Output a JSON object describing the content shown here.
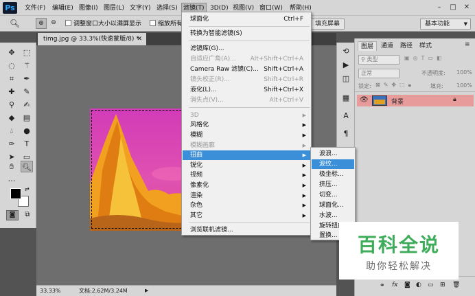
{
  "app": {
    "logo": "Ps"
  },
  "menubar": {
    "items": [
      "文件(F)",
      "编辑(E)",
      "图像(I)",
      "图层(L)",
      "文字(Y)",
      "选择(S)",
      "滤镜(T)",
      "3D(D)",
      "视图(V)",
      "窗口(W)",
      "帮助(H)"
    ],
    "active_index": 6
  },
  "options_bar": {
    "resize_windows": "调整窗口大小以满屏显示",
    "zoom_all": "缩放所有",
    "fill_screen": "填充屏幕",
    "workspace": "基本功能"
  },
  "document": {
    "tab_title": "timg.jpg @ 33.3%(快速蒙版/8) *",
    "zoom": "33.33%",
    "doc_info": "文档:2.62M/3.24M"
  },
  "filter_menu": {
    "items": [
      {
        "label": "球面化",
        "shortcut": "Ctrl+F",
        "disabled": false
      },
      {
        "label": "转换为智能滤镜(S)",
        "disabled": false
      },
      {
        "label": "滤镜库(G)...",
        "disabled": false
      },
      {
        "label": "自适应广角(A)...",
        "shortcut": "Alt+Shift+Ctrl+A",
        "disabled": true
      },
      {
        "label": "Camera Raw 滤镜(C)...",
        "shortcut": "Shift+Ctrl+A",
        "disabled": false
      },
      {
        "label": "镜头校正(R)...",
        "shortcut": "Shift+Ctrl+R",
        "disabled": true
      },
      {
        "label": "液化(L)...",
        "shortcut": "Shift+Ctrl+X",
        "disabled": false
      },
      {
        "label": "消失点(V)...",
        "shortcut": "Alt+Ctrl+V",
        "disabled": true
      },
      {
        "label": "3D",
        "submenu": true,
        "disabled": true
      },
      {
        "label": "风格化",
        "submenu": true,
        "disabled": false
      },
      {
        "label": "模糊",
        "submenu": true,
        "disabled": false
      },
      {
        "label": "模糊画廊",
        "submenu": true,
        "disabled": true
      },
      {
        "label": "扭曲",
        "submenu": true,
        "disabled": false,
        "highlighted": true
      },
      {
        "label": "锐化",
        "submenu": true,
        "disabled": false
      },
      {
        "label": "视频",
        "submenu": true,
        "disabled": false
      },
      {
        "label": "像素化",
        "submenu": true,
        "disabled": false
      },
      {
        "label": "渲染",
        "submenu": true,
        "disabled": false
      },
      {
        "label": "杂色",
        "submenu": true,
        "disabled": false
      },
      {
        "label": "其它",
        "submenu": true,
        "disabled": false
      },
      {
        "label": "浏览联机滤镜...",
        "disabled": false
      }
    ]
  },
  "distort_submenu": {
    "items": [
      "波浪...",
      "波纹...",
      "极坐标...",
      "挤压...",
      "切变...",
      "球面化...",
      "水波...",
      "旋转扭曲...",
      "置换..."
    ],
    "highlighted_index": 1
  },
  "layers_panel": {
    "tabs": [
      "图层",
      "通道",
      "路径",
      "样式"
    ],
    "kind_filter": "类型",
    "blend_mode": "正常",
    "opacity_label": "不透明度:",
    "opacity_value": "100%",
    "lock_label": "锁定:",
    "fill_label": "填充:",
    "fill_value": "100%",
    "layer_name": "背景",
    "footer_icons": [
      "link-icon",
      "fx-icon",
      "mask-icon",
      "adjustment-icon",
      "folder-icon",
      "new-layer-icon",
      "trash-icon"
    ]
  },
  "watermark": {
    "title": "百科全说",
    "subtitle": "助你轻松解决"
  },
  "colors": {
    "menu_highlight": "#3a8fd8",
    "layer_row": "#e79b9b",
    "watermark_green": "#3eac5a"
  }
}
